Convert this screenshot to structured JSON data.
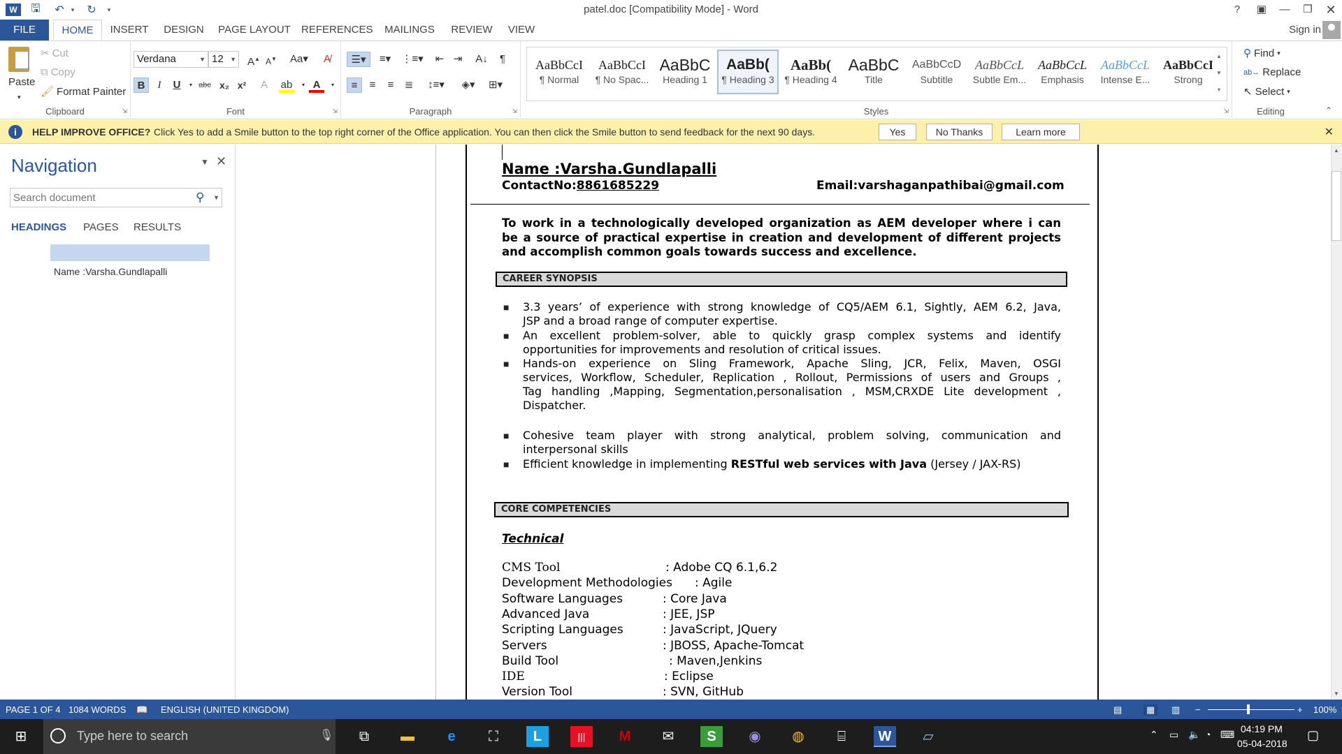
{
  "window": {
    "title": "patel.doc [Compatibility Mode] - Word",
    "help": "?",
    "signin": "Sign in"
  },
  "tabs": [
    "FILE",
    "HOME",
    "INSERT",
    "DESIGN",
    "PAGE LAYOUT",
    "REFERENCES",
    "MAILINGS",
    "REVIEW",
    "VIEW"
  ],
  "clipboard": {
    "paste": "Paste",
    "cut": "Cut",
    "copy": "Copy",
    "format_painter": "Format Painter",
    "label": "Clipboard"
  },
  "font": {
    "family": "Verdana",
    "size": "12",
    "label": "Font",
    "bold": "B",
    "italic": "I",
    "underline": "U",
    "strike": "abc",
    "sub": "x₂",
    "sup": "x²"
  },
  "paragraph": {
    "label": "Paragraph"
  },
  "styles": {
    "label": "Styles",
    "items": [
      {
        "preview": "AaBbCcI",
        "name": "¶ Normal"
      },
      {
        "preview": "AaBbCcI",
        "name": "¶ No Spac..."
      },
      {
        "preview": "AaBbC",
        "name": "Heading 1"
      },
      {
        "preview": "AaBb(",
        "name": "¶ Heading 3"
      },
      {
        "preview": "AaBb(",
        "name": "¶ Heading 4"
      },
      {
        "preview": "AaBbC",
        "name": "Title"
      },
      {
        "preview": "AaBbCcD",
        "name": "Subtitle"
      },
      {
        "preview": "AaBbCcL",
        "name": "Subtle Em..."
      },
      {
        "preview": "AaBbCcL",
        "name": "Emphasis"
      },
      {
        "preview": "AaBbCcL",
        "name": "Intense E..."
      },
      {
        "preview": "AaBbCcI",
        "name": "Strong"
      }
    ]
  },
  "editing": {
    "label": "Editing",
    "find": "Find",
    "replace": "Replace",
    "select": "Select"
  },
  "banner": {
    "title": "HELP IMPROVE OFFICE?",
    "text": "Click Yes to add a Smile button to the top right corner of the Office application. You can then click the Smile button to send feedback for the next 90 days.",
    "yes": "Yes",
    "no": "No Thanks",
    "learn": "Learn more"
  },
  "nav": {
    "title": "Navigation",
    "search_placeholder": "Search document",
    "tabs": [
      "HEADINGS",
      "PAGES",
      "RESULTS"
    ],
    "heading_item": "Name :Varsha.Gundlapalli"
  },
  "document": {
    "name": "Name :Varsha.Gundlapalli",
    "contact_label": "ContactNo:",
    "contact": "8861685229",
    "email": "Email:varshaganpathibai@gmail.com",
    "objective_lines": [
      "To work in a technologically developed organization as AEM developer where i can",
      "be a source of practical expertise in creation and development of different projects",
      "and accomplish common goals towards success and excellence."
    ],
    "sec_career": "CAREER SYNOPSIS",
    "bullets": [
      [
        "3.3 years’ of experience with strong knowledge of CQ5/AEM 6.1, Sightly, AEM 6.2,  Java,",
        "JSP and a broad range of computer expertise."
      ],
      [
        " An  excellent  problem-solver,  able  to  quickly  grasp  complex  systems  and  identify",
        "opportunities for improvements and resolution of critical issues."
      ],
      [
        "  Hands-on  experience  on  Sling  Framework,  Apache  Sling,  JCR,  Felix,  Maven,  OSGI",
        "services, Workflow, Scheduler,  Replication , Rollout, Permissions of users and Groups ,",
        "Tag  handling  ,Mapping,  Segmentation,personalisation  ,  MSM,CRXDE  Lite  development  ,",
        "Dispatcher."
      ],
      [
        "Cohesive  team  player  with  strong  analytical,  problem  solving,  communication  and",
        "interpersonal skills"
      ]
    ],
    "last_bullet_pre": "Efficient knowledge in implementing ",
    "last_bullet_bold": "RESTful web services with Java",
    "last_bullet_post": " (Jersey / JAX-RS)",
    "sec_core": "CORE COMPETENCIES",
    "technical": "Technical",
    "skills": [
      {
        "k": "CMS Tool",
        "v": ": Adobe CQ 6.1,6.2"
      },
      {
        "k": "Development Methodologies",
        "v": ": Agile"
      },
      {
        "k": "Software Languages",
        "v": ": Core Java"
      },
      {
        "k": "Advanced Java",
        "v": ": JEE, JSP"
      },
      {
        "k": "Scripting Languages",
        "v": ": JavaScript, JQuery"
      },
      {
        "k": "Servers",
        "v": ": JBOSS, Apache-Tomcat"
      },
      {
        "k": "Build Tool",
        "v": ": Maven,Jenkins"
      },
      {
        "k": "IDE",
        "v": ": Eclipse"
      },
      {
        "k": "Version Tool",
        "v": ": SVN, GitHub"
      }
    ]
  },
  "status": {
    "page": "PAGE 1 OF 4",
    "words": "1084 WORDS",
    "lang": "ENGLISH (UNITED KINGDOM)",
    "zoom": "100%"
  },
  "taskbar": {
    "search": "Type here to search",
    "time": "04:19 PM",
    "date": "05-04-2018"
  },
  "colors": {
    "accent": "#2b579a",
    "banner": "#fdf0ab"
  }
}
